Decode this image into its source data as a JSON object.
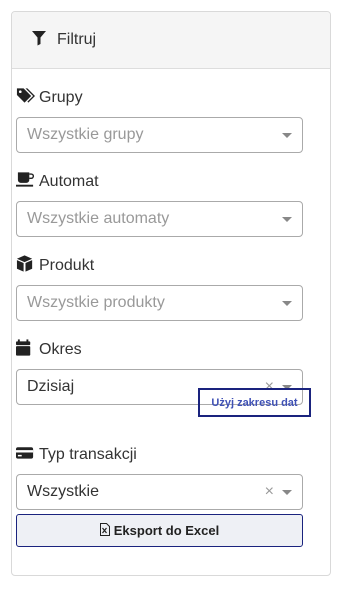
{
  "panel": {
    "title": "Filtruj",
    "icon": "filter-icon"
  },
  "filters": {
    "groups": {
      "label": "Grupy",
      "icon": "tags-icon",
      "placeholder": "Wszystkie grupy"
    },
    "machine": {
      "label": "Automat",
      "icon": "coffee-icon",
      "placeholder": "Wszystkie automaty"
    },
    "product": {
      "label": "Produkt",
      "icon": "box-icon",
      "placeholder": "Wszystkie produkty"
    },
    "period": {
      "label": "Okres",
      "icon": "calendar-icon",
      "value": "Dzisiaj",
      "clear": "×",
      "date_range_link": "Użyj zakresu dat"
    },
    "transaction_type": {
      "label": "Typ transakcji",
      "icon": "credit-card-icon",
      "value": "Wszystkie",
      "clear": "×"
    }
  },
  "export": {
    "label": "Eksport do Excel",
    "icon": "file-excel-icon"
  }
}
